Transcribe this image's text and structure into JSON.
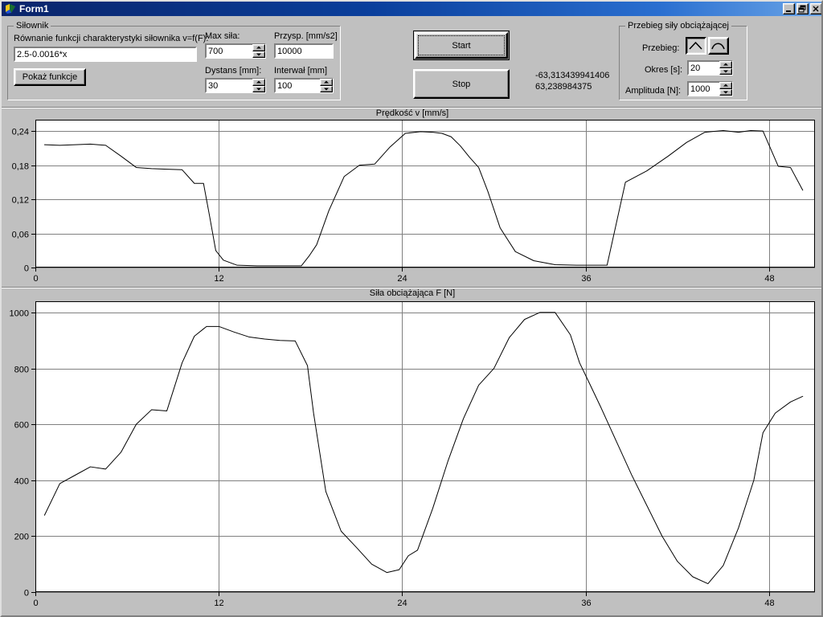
{
  "window": {
    "title": "Form1",
    "icon": "vb-form-icon",
    "buttons": [
      {
        "name": "minimize-button",
        "glyph": "minimize-icon"
      },
      {
        "name": "restore-button",
        "glyph": "restore-icon"
      },
      {
        "name": "close-button",
        "glyph": "close-icon"
      }
    ]
  },
  "silownik": {
    "group_title": "Siłownik",
    "equation_label": "Równanie funkcji charakterystyki siłownika v=f(F):",
    "equation_value": "2.5-0.0016*x",
    "show_functions_button": "Pokaż funkcje",
    "max_force_label": "Max siła:",
    "max_force_value": "700",
    "accel_label": "Przysp. [mm/s2]",
    "accel_value": "10000",
    "distance_label": "Dystans [mm]:",
    "distance_value": "30",
    "interval_label": "Interwał [mm]",
    "interval_value": "100"
  },
  "controls": {
    "start_button": "Start",
    "stop_button": "Stop",
    "readout_line1": "-63,313439941406",
    "readout_line2": "63,238984375"
  },
  "przebieg": {
    "group_title": "Przebieg siły obciążającej",
    "waveform_label": "Przebieg:",
    "waveform_options": [
      "triangle-wave-icon",
      "sine-wave-icon"
    ],
    "waveform_selected": 0,
    "period_label": "Okres [s]:",
    "period_value": "20",
    "amplitude_label": "Amplituda [N]:",
    "amplitude_value": "1000"
  },
  "colors": {
    "face": "#c0c0c0",
    "plot_bg": "#ffffff",
    "grid": "#808080",
    "trace": "#000000",
    "title_bar_start": "#0a246a",
    "title_bar_end": "#6ba5e7"
  },
  "chart_data": [
    {
      "type": "line",
      "title": "Prędkość v [mm/s]",
      "xlabel": "",
      "ylabel": "",
      "grid": true,
      "legend": "none",
      "xlim": [
        0,
        51
      ],
      "ylim": [
        0,
        0.26
      ],
      "xticks": [
        0,
        12,
        24,
        36,
        48
      ],
      "yticks": [
        0,
        0.06,
        0.12,
        0.18,
        0.24
      ],
      "ytick_labels": [
        "0",
        "0,06",
        "0,12",
        "0,18",
        "0,24"
      ],
      "xtick_labels": [
        "0",
        "12",
        "24",
        "36",
        "48"
      ],
      "x": [
        0.6,
        1.6,
        2.6,
        3.6,
        4.6,
        5.6,
        6.6,
        7.6,
        8.6,
        9.6,
        10.4,
        10.7,
        11.0,
        11.4,
        11.8,
        12.3,
        13.2,
        14.5,
        16.0,
        17.4,
        17.9,
        18.4,
        19.2,
        20.2,
        21.2,
        22.2,
        23.2,
        24.2,
        25.2,
        26.0,
        26.6,
        27.2,
        27.8,
        28.4,
        29.0,
        29.6,
        30.4,
        31.4,
        32.6,
        34.0,
        35.4,
        36.0,
        36.6,
        37.4,
        38.6,
        40.0,
        41.4,
        42.6,
        43.8,
        45.0,
        46.0,
        46.8,
        47.6,
        48.6,
        49.4,
        50.2
      ],
      "y": [
        0.216,
        0.215,
        0.216,
        0.217,
        0.215,
        0.196,
        0.176,
        0.174,
        0.173,
        0.172,
        0.148,
        0.148,
        0.148,
        0.09,
        0.03,
        0.013,
        0.004,
        0.003,
        0.003,
        0.003,
        0.02,
        0.04,
        0.1,
        0.16,
        0.18,
        0.182,
        0.212,
        0.236,
        0.239,
        0.238,
        0.236,
        0.23,
        0.214,
        0.194,
        0.176,
        0.134,
        0.07,
        0.028,
        0.012,
        0.005,
        0.004,
        0.004,
        0.004,
        0.004,
        0.15,
        0.17,
        0.196,
        0.22,
        0.238,
        0.241,
        0.238,
        0.241,
        0.24,
        0.178,
        0.176,
        0.136
      ]
    },
    {
      "type": "line",
      "title": "Siła obciążająca F [N]",
      "xlabel": "",
      "ylabel": "",
      "grid": true,
      "legend": "none",
      "xlim": [
        0,
        51
      ],
      "ylim": [
        0,
        1040
      ],
      "xticks": [
        0,
        12,
        24,
        36,
        48
      ],
      "yticks": [
        0,
        200,
        400,
        600,
        800,
        1000
      ],
      "ytick_labels": [
        "0",
        "200",
        "400",
        "600",
        "800",
        "1000"
      ],
      "xtick_labels": [
        "0",
        "12",
        "24",
        "36",
        "48"
      ],
      "x": [
        0.6,
        1.6,
        2.6,
        3.6,
        4.6,
        5.6,
        6.6,
        7.6,
        8.6,
        9.6,
        10.4,
        11.2,
        12.0,
        13.0,
        14.0,
        15.0,
        16.0,
        17.0,
        17.8,
        18.2,
        19.0,
        20.0,
        21.0,
        22.0,
        23.0,
        23.8,
        24.4,
        25.0,
        26.0,
        27.0,
        28.0,
        29.0,
        30.0,
        31.0,
        32.0,
        33.0,
        34.0,
        35.0,
        35.6,
        36.2,
        37.0,
        38.0,
        39.0,
        40.0,
        41.0,
        42.0,
        43.0,
        44.0,
        45.0,
        46.0,
        47.0,
        47.6,
        48.4,
        49.4,
        50.2
      ],
      "y": [
        275,
        388,
        418,
        448,
        440,
        500,
        600,
        652,
        648,
        820,
        915,
        950,
        950,
        930,
        912,
        905,
        900,
        898,
        810,
        640,
        360,
        218,
        160,
        100,
        70,
        80,
        130,
        150,
        300,
        470,
        620,
        740,
        800,
        910,
        975,
        1000,
        1000,
        920,
        820,
        752,
        660,
        540,
        420,
        310,
        200,
        110,
        55,
        30,
        95,
        230,
        400,
        570,
        640,
        680,
        700
      ]
    }
  ]
}
